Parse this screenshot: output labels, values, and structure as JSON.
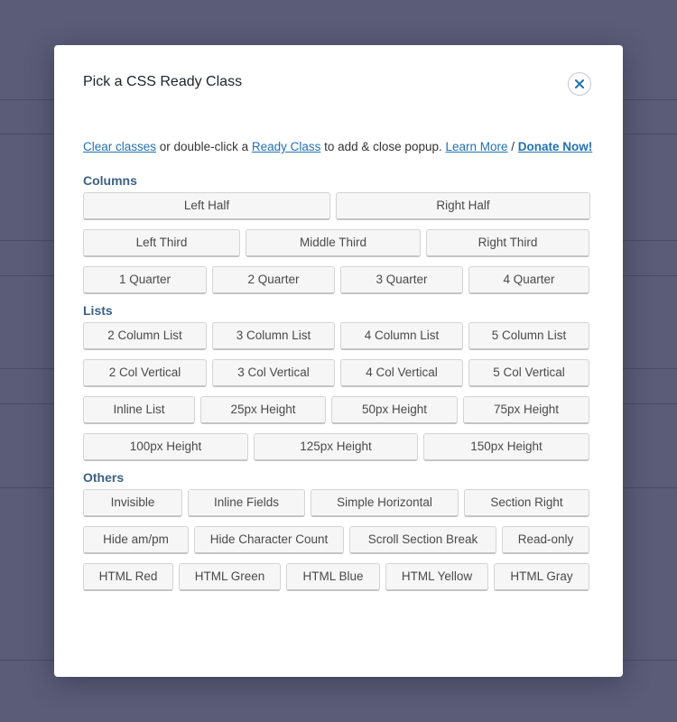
{
  "modal": {
    "title": "Pick a CSS Ready Class",
    "close_icon": "close-icon"
  },
  "help": {
    "clear_link": "Clear classes",
    "text1": " or double-click a ",
    "ready_link": "Ready Class",
    "text2": " to add & close popup. ",
    "learn_link": "Learn More",
    "sep": " / ",
    "donate_link": "Donate Now!"
  },
  "colors": {
    "overlay": "#5b5c78",
    "section_label": "#3c6184",
    "link": "#2271b1",
    "button_bg": "#f6f6f6"
  },
  "sections": {
    "columns": {
      "label": "Columns",
      "rows": [
        [
          "Left Half",
          "Right Half"
        ],
        [
          "Left Third",
          "Middle Third",
          "Right Third"
        ],
        [
          "1 Quarter",
          "2 Quarter",
          "3 Quarter",
          "4 Quarter"
        ]
      ]
    },
    "lists": {
      "label": "Lists",
      "rows": [
        [
          "2 Column List",
          "3 Column List",
          "4 Column List",
          "5 Column List"
        ],
        [
          "2 Col Vertical",
          "3 Col Vertical",
          "4 Col Vertical",
          "5 Col Vertical"
        ],
        [
          "Inline List",
          "25px Height",
          "50px Height",
          "75px Height"
        ],
        [
          "100px Height",
          "125px Height",
          "150px Height"
        ]
      ]
    },
    "others": {
      "label": "Others",
      "rows": [
        [
          "Invisible",
          "Inline Fields",
          "Simple Horizontal",
          "Section Right"
        ],
        [
          "Hide am/pm",
          "Hide Character Count",
          "Scroll Section Break",
          "Read-only"
        ],
        [
          "HTML Red",
          "HTML Green",
          "HTML Blue",
          "HTML Yellow",
          "HTML Gray"
        ]
      ]
    }
  }
}
